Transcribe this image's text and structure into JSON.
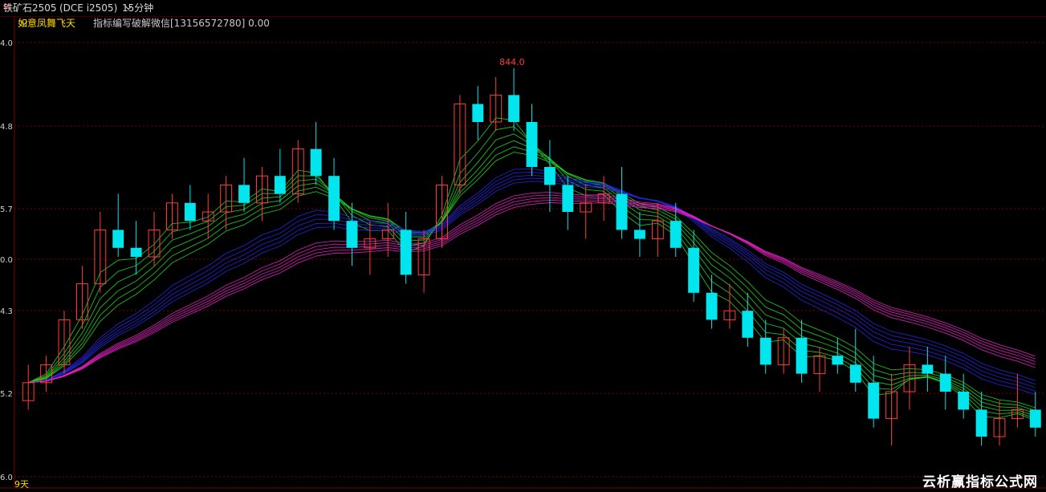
{
  "header": {
    "symbol": "铁矿石2505",
    "symbol_mark": "M",
    "code": "(DCE i2505)",
    "period": "15分钟"
  },
  "indicator": {
    "name": "如意凤舞飞天",
    "description": "指标编写破解微信[13156572780] 0.00"
  },
  "bottom_label": "9天",
  "watermark": "云析赢指标公式网",
  "colors": {
    "up": "#ff3c3c",
    "down": "#00e5ee",
    "fast_band": "#1fd01f",
    "mid_band": "#2626e0",
    "slow_band": "#e020c0",
    "grid": "#7a0000"
  },
  "chart_data": {
    "type": "candlestick",
    "y_tick_labels": [
      "4.0",
      "4.8",
      "5.7",
      "0.0",
      "4.3",
      "5.2",
      "6.0"
    ],
    "high_label": "844.0",
    "grid": true,
    "candles_ohlc": [
      [
        807,
        811,
        806,
        809
      ],
      [
        809,
        812,
        808,
        811
      ],
      [
        811,
        817,
        810,
        816
      ],
      [
        816,
        822,
        815,
        820
      ],
      [
        820,
        828,
        819,
        826
      ],
      [
        826,
        830,
        823,
        824
      ],
      [
        824,
        827,
        821,
        823
      ],
      [
        823,
        828,
        822,
        826
      ],
      [
        826,
        830,
        825,
        829
      ],
      [
        829,
        831,
        826,
        827
      ],
      [
        827,
        830,
        825,
        828
      ],
      [
        828,
        832,
        826,
        831
      ],
      [
        831,
        834,
        828,
        829
      ],
      [
        829,
        833,
        827,
        832
      ],
      [
        832,
        835,
        829,
        830
      ],
      [
        830,
        836,
        829,
        835
      ],
      [
        835,
        838,
        831,
        832
      ],
      [
        832,
        834,
        826,
        827
      ],
      [
        827,
        829,
        822,
        824
      ],
      [
        824,
        827,
        821,
        825
      ],
      [
        825,
        829,
        823,
        826
      ],
      [
        826,
        828,
        820,
        821
      ],
      [
        821,
        826,
        819,
        825
      ],
      [
        825,
        832,
        824,
        831
      ],
      [
        831,
        841,
        830,
        840
      ],
      [
        840,
        842,
        836,
        838
      ],
      [
        838,
        843,
        837,
        841
      ],
      [
        841,
        844,
        837,
        838
      ],
      [
        838,
        840,
        832,
        833
      ],
      [
        833,
        836,
        828,
        831
      ],
      [
        831,
        832,
        826,
        828
      ],
      [
        828,
        831,
        825,
        829
      ],
      [
        829,
        832,
        827,
        830
      ],
      [
        830,
        833,
        825,
        826
      ],
      [
        826,
        828,
        823,
        825
      ],
      [
        825,
        829,
        823,
        827
      ],
      [
        827,
        829,
        823,
        824
      ],
      [
        824,
        826,
        818,
        819
      ],
      [
        819,
        821,
        815,
        816
      ],
      [
        816,
        820,
        815,
        817
      ],
      [
        817,
        819,
        813,
        814
      ],
      [
        814,
        816,
        810,
        811
      ],
      [
        811,
        815,
        810,
        814
      ],
      [
        814,
        816,
        809,
        810
      ],
      [
        810,
        813,
        808,
        812
      ],
      [
        812,
        814,
        810,
        811
      ],
      [
        811,
        815,
        808,
        809
      ],
      [
        809,
        812,
        804,
        805
      ],
      [
        805,
        810,
        802,
        808
      ],
      [
        808,
        813,
        806,
        811
      ],
      [
        811,
        813,
        808,
        810
      ],
      [
        810,
        812,
        806,
        808
      ],
      [
        808,
        810,
        805,
        806
      ],
      [
        806,
        808,
        802,
        803
      ],
      [
        803,
        807,
        802,
        805
      ],
      [
        805,
        810,
        804,
        806
      ],
      [
        806,
        808,
        803,
        804
      ]
    ]
  }
}
